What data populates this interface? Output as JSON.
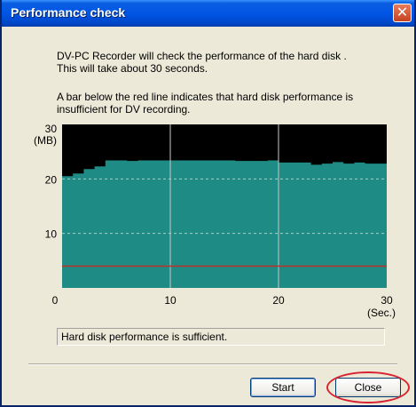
{
  "window": {
    "title": "Performance check",
    "close_glyph": "✕"
  },
  "message": {
    "line1": "DV-PC Recorder will check the performance of the hard disk .",
    "line2": "This will take about 30 seconds.",
    "line3": "A bar below the red line indicates that hard disk performance is",
    "line4": "insufficient for DV recording."
  },
  "chart_data": {
    "type": "area",
    "ylabel_value": "30",
    "ylabel_unit": "(MB)",
    "xlabel_unit": "(Sec.)",
    "xlim": [
      0,
      30
    ],
    "ylim": [
      0,
      30
    ],
    "y_ticks": [
      20,
      10
    ],
    "x_ticks": [
      0,
      10,
      20,
      30
    ],
    "threshold": 4,
    "colors": {
      "background": "#000000",
      "fill": "#1e8b85",
      "threshold": "#c0302a",
      "grid": "#ffffff"
    },
    "x": [
      0,
      1,
      2,
      3,
      4,
      5,
      6,
      7,
      8,
      9,
      10,
      11,
      12,
      13,
      14,
      15,
      16,
      17,
      18,
      19,
      20,
      21,
      22,
      23,
      24,
      25,
      26,
      27,
      28,
      29,
      30
    ],
    "values": [
      20.5,
      21.0,
      21.8,
      22.3,
      23.4,
      23.4,
      23.3,
      23.4,
      23.4,
      23.4,
      23.4,
      23.4,
      23.4,
      23.4,
      23.4,
      23.4,
      23.3,
      23.3,
      23.3,
      23.4,
      23.0,
      23.0,
      23.0,
      22.6,
      22.8,
      23.1,
      22.8,
      23.0,
      22.8,
      22.8,
      22.8
    ]
  },
  "status": {
    "text": "Hard disk performance is sufficient."
  },
  "buttons": {
    "start_label": "Start",
    "close_label": "Close"
  }
}
